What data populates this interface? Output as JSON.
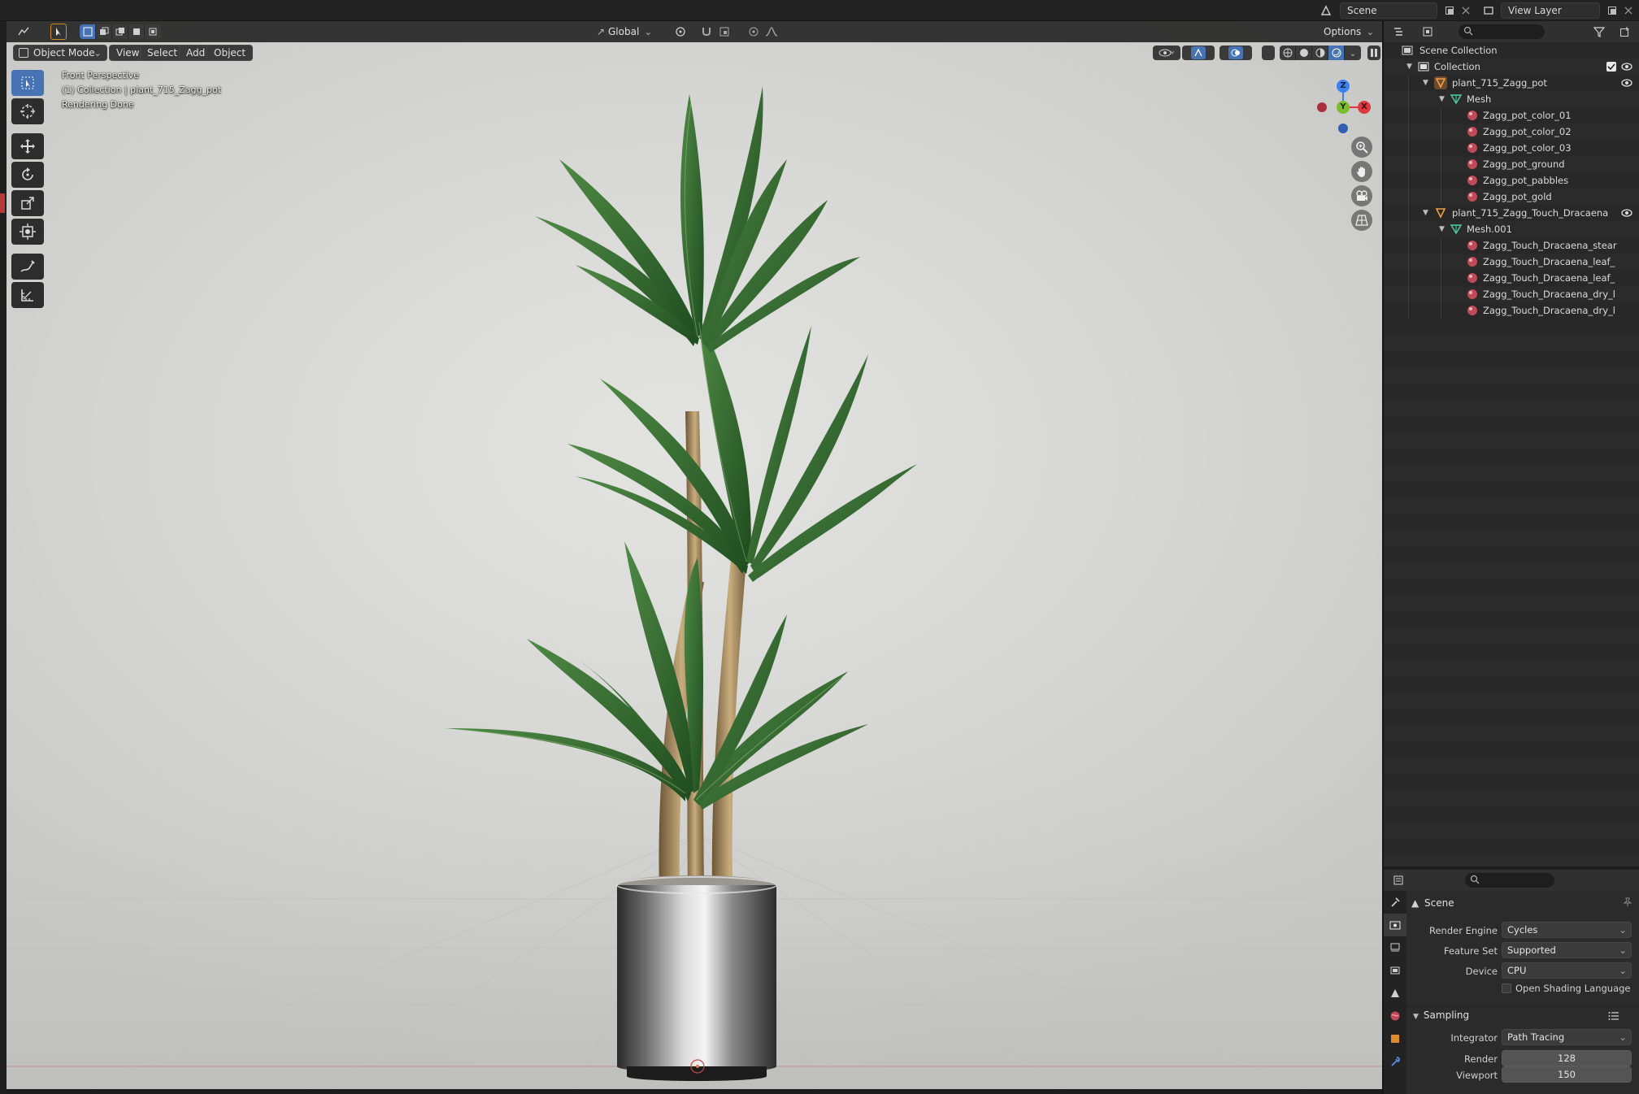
{
  "topbar": {
    "scene_label": "Scene",
    "view_layer_label": "View Layer"
  },
  "viewport": {
    "mode_label": "Object Mode",
    "menus": [
      "View",
      "Select",
      "Add",
      "Object"
    ],
    "transform_orientation": "Global",
    "options_label": "Options",
    "overlay_lines": [
      "Front Perspective",
      "(1) Collection | plant_715_Zagg_pot",
      "Rendering Done"
    ],
    "gizmo_axes": {
      "z": "Z",
      "y": "Y",
      "x": "X"
    },
    "colors": {
      "accent": "#4772b3",
      "axis_x": "#e0383e",
      "axis_y": "#7cbd2c",
      "axis_z": "#3b83f0"
    }
  },
  "outliner": {
    "root": "Scene Collection",
    "items": [
      {
        "label": "Collection",
        "type": "collection"
      },
      {
        "label": "plant_715_Zagg_pot",
        "type": "object"
      },
      {
        "label": "Mesh",
        "type": "mesh"
      },
      {
        "label": "Zagg_pot_color_01",
        "type": "material"
      },
      {
        "label": "Zagg_pot_color_02",
        "type": "material"
      },
      {
        "label": "Zagg_pot_color_03",
        "type": "material"
      },
      {
        "label": "Zagg_pot_ground",
        "type": "material"
      },
      {
        "label": "Zagg_pot_pabbles",
        "type": "material"
      },
      {
        "label": "Zagg_pot_gold",
        "type": "material"
      },
      {
        "label": "plant_715_Zagg_Touch_Dracaena",
        "type": "object"
      },
      {
        "label": "Mesh.001",
        "type": "mesh"
      },
      {
        "label": "Zagg_Touch_Dracaena_stear",
        "type": "material"
      },
      {
        "label": "Zagg_Touch_Dracaena_leaf_",
        "type": "material"
      },
      {
        "label": "Zagg_Touch_Dracaena_leaf_",
        "type": "material"
      },
      {
        "label": "Zagg_Touch_Dracaena_dry_l",
        "type": "material"
      },
      {
        "label": "Zagg_Touch_Dracaena_dry_l",
        "type": "material"
      }
    ]
  },
  "properties": {
    "context": "Scene",
    "render_engine_label": "Render Engine",
    "render_engine_value": "Cycles",
    "feature_set_label": "Feature Set",
    "feature_set_value": "Supported",
    "device_label": "Device",
    "device_value": "CPU",
    "osl_label": "Open Shading Language",
    "sampling_label": "Sampling",
    "integrator_label": "Integrator",
    "integrator_value": "Path Tracing",
    "render_label": "Render",
    "render_value": "128",
    "viewport_label": "Viewport",
    "viewport_value": "150"
  }
}
